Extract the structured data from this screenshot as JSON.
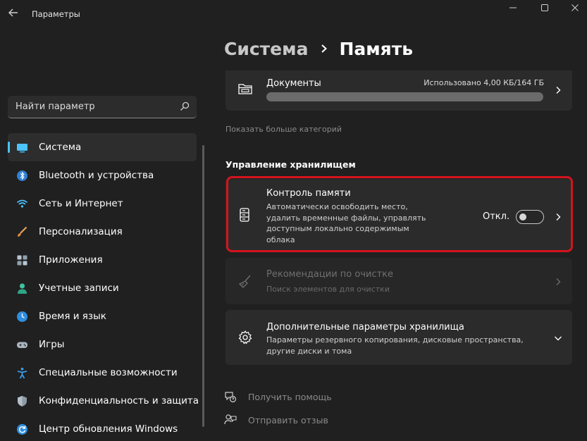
{
  "window": {
    "title": "Параметры"
  },
  "search": {
    "placeholder": "Найти параметр"
  },
  "sidebar": {
    "items": [
      {
        "label": "Система",
        "icon": "monitor-icon",
        "active": true
      },
      {
        "label": "Bluetooth и устройства",
        "icon": "bluetooth-icon"
      },
      {
        "label": "Сеть и Интернет",
        "icon": "wifi-icon"
      },
      {
        "label": "Персонализация",
        "icon": "brush-icon"
      },
      {
        "label": "Приложения",
        "icon": "apps-icon"
      },
      {
        "label": "Учетные записи",
        "icon": "person-icon"
      },
      {
        "label": "Время и язык",
        "icon": "globe-clock-icon"
      },
      {
        "label": "Игры",
        "icon": "gamepad-icon"
      },
      {
        "label": "Специальные возможности",
        "icon": "accessibility-icon"
      },
      {
        "label": "Конфиденциальность и защита",
        "icon": "shield-icon"
      },
      {
        "label": "Центр обновления Windows",
        "icon": "update-icon"
      }
    ]
  },
  "breadcrumb": {
    "parent": "Система",
    "current": "Память"
  },
  "documents": {
    "title": "Документы",
    "usage": "Использовано 4,00 КБ/164 ГБ",
    "fraction_used": 0.0
  },
  "more_categories": "Показать больше категорий",
  "storage_management": {
    "section_title": "Управление хранилищем",
    "storage_sense": {
      "title": "Контроль памяти",
      "description": "Автоматически освободить место, удалить временные файлы, управлять доступным локально содержимым облака",
      "toggle_label": "Откл.",
      "toggle_on": false
    },
    "cleanup": {
      "title": "Рекомендации по очистке",
      "description": "Поиск элементов для очистки"
    },
    "advanced": {
      "title": "Дополнительные параметры хранилища",
      "description": "Параметры резервного копирования, дисковые пространства, другие диски и тома"
    }
  },
  "footer": {
    "help": "Получить помощь",
    "feedback": "Отправить отзыв"
  },
  "colors": {
    "accent": "#4cc2ff",
    "highlight": "#d4141e",
    "background": "#202020",
    "card": "#2b2b2b"
  }
}
